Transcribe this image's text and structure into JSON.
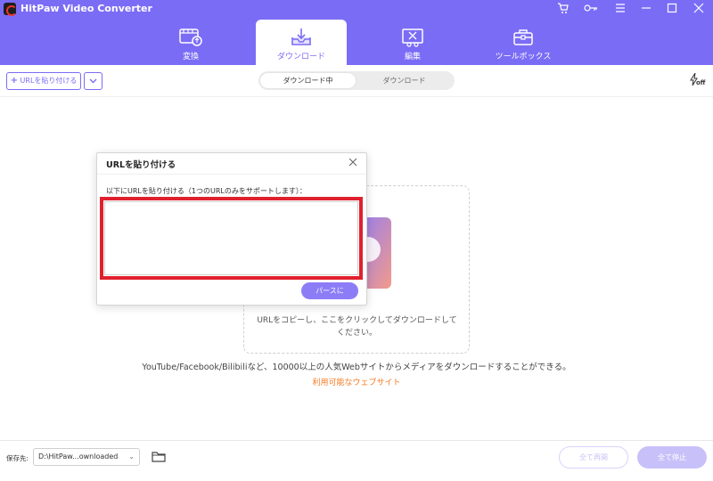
{
  "app": {
    "title": "HitPaw Video Converter"
  },
  "nav": {
    "tabs": [
      {
        "label": "変換"
      },
      {
        "label": "ダウンロード"
      },
      {
        "label": "編集"
      },
      {
        "label": "ツールボックス"
      }
    ]
  },
  "toolbar": {
    "paste_url_label": "URLを貼り付ける",
    "segments": [
      "ダウンロード中",
      "ダウンロード"
    ],
    "turbo_label": "off"
  },
  "dropzone": {
    "instruction": "URLをコピーし、ここをクリックしてダウンロードしてください。",
    "supported_sites": "YouTube/Facebook/Bilibiliなど、10000以上の人気Webサイトからメディアをダウンロードすることができる。",
    "sites_link": "利用可能なウェブサイト"
  },
  "dialog": {
    "title": "URLを貼り付ける",
    "hint": "以下にURLを貼り付ける（1つのURLのみをサポートします）：",
    "input_value": "",
    "parse_button": "パースに"
  },
  "footer": {
    "save_label": "保存先:",
    "save_path": "D:\\HitPaw...ownloaded",
    "resume_all": "全て再開",
    "pause_all": "全て停止"
  },
  "colors": {
    "brand": "#7b6cf6",
    "highlight_border": "#e0202e",
    "link": "#f57a21"
  }
}
